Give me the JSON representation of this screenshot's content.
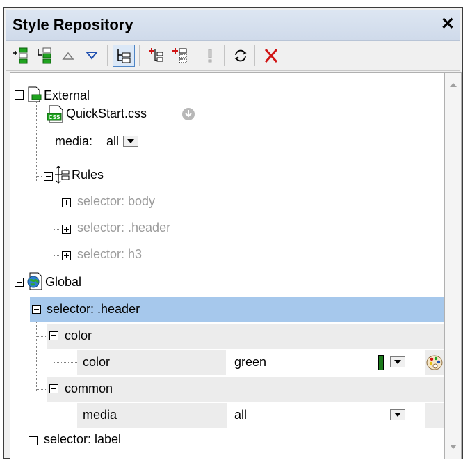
{
  "window": {
    "title": "Style Repository",
    "close_glyph": "✕"
  },
  "toolbar": {
    "buttons": [
      {
        "name": "add-stylesheet-icon"
      },
      {
        "name": "insert-stylesheet-icon"
      },
      {
        "name": "move-up-icon"
      },
      {
        "name": "move-down-icon"
      },
      {
        "name": "toggle-tree-view-icon"
      },
      {
        "name": "add-rule-icon"
      },
      {
        "name": "insert-rule-icon"
      },
      {
        "name": "override-icon"
      },
      {
        "name": "reload-icon"
      },
      {
        "name": "delete-icon"
      }
    ],
    "colors": {
      "green": "#1fa31f",
      "red": "#d01414",
      "blue": "#2050b0"
    }
  },
  "tree": {
    "external": {
      "label": "External",
      "file": "QuickStart.css",
      "media_label": "media:",
      "media_value": "all",
      "rules_label": "Rules",
      "selectors": [
        "selector: body",
        "selector: .header",
        "selector: h3"
      ]
    },
    "global": {
      "label": "Global",
      "selected_selector": "selector: .header",
      "color_group": "color",
      "color_prop": "color",
      "color_value": "green",
      "common_group": "common",
      "media_prop": "media",
      "media_value": "all",
      "other_selector": "selector: label"
    },
    "highlight_color": "#a6c8ec",
    "group_band_color": "#ececec",
    "color_swatch": "#1b7a1b"
  }
}
